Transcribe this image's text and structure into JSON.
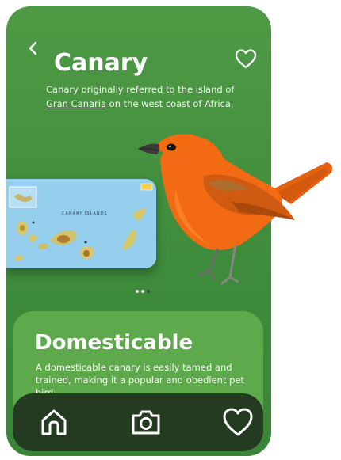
{
  "header": {
    "title": "Canary",
    "back_icon": "chevron-left-icon",
    "favorite_icon": "heart-outline-icon"
  },
  "description": {
    "text_before": "Canary originally referred to the island of ",
    "link_text": "Gran Canaria",
    "text_after": " on the west coast of Africa,"
  },
  "map": {
    "label": "CANARY ISLANDS"
  },
  "carousel": {
    "count": 3,
    "active_index": 2
  },
  "feature_card": {
    "title": "Domesticable",
    "text": "A domesticable canary is easily tamed and trained, making it a popular and obedient pet bird."
  },
  "bottom_nav": {
    "items": [
      {
        "icon": "home-icon"
      },
      {
        "icon": "camera-icon"
      },
      {
        "icon": "heart-icon"
      }
    ]
  },
  "colors": {
    "background": "#4a9442",
    "card": "#5fa94d",
    "nav": "#243b22",
    "bird": "#f26a13"
  }
}
